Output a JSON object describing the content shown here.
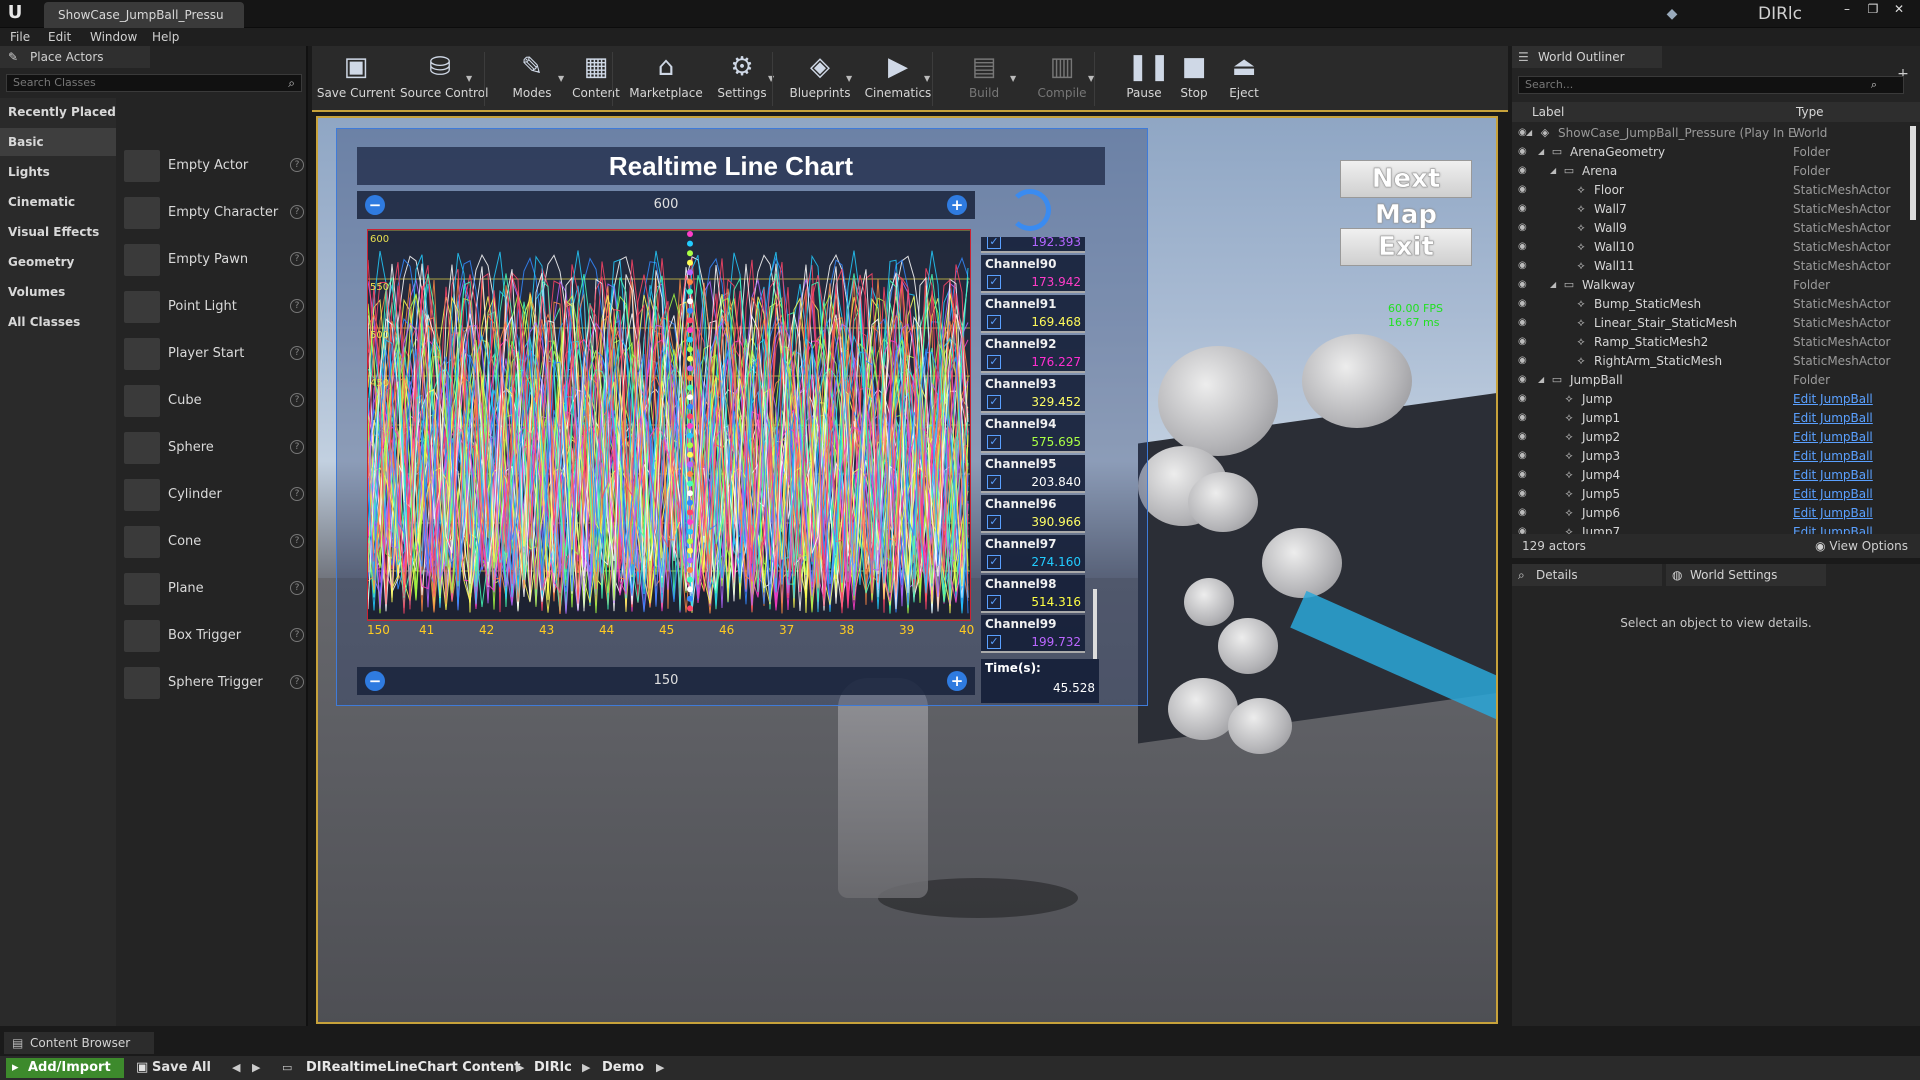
{
  "app": {
    "doc_tab": "ShowCase_JumpBall_Pressu",
    "brand": "DIRlc"
  },
  "menu": [
    "File",
    "Edit",
    "Window",
    "Help"
  ],
  "place_actors": {
    "tab_label": "Place Actors",
    "search_placeholder": "Search Classes",
    "categories": [
      "Recently Placed",
      "Basic",
      "Lights",
      "Cinematic",
      "Visual Effects",
      "Geometry",
      "Volumes",
      "All Classes"
    ],
    "active_category": "Basic",
    "items": [
      "Empty Actor",
      "Empty Character",
      "Empty Pawn",
      "Point Light",
      "Player Start",
      "Cube",
      "Sphere",
      "Cylinder",
      "Cone",
      "Plane",
      "Box Trigger",
      "Sphere Trigger"
    ]
  },
  "toolbar": {
    "items": [
      {
        "label": "Save Current",
        "icon": "save-icon"
      },
      {
        "label": "Source Control",
        "icon": "source-control-icon"
      },
      {
        "label": "Modes",
        "icon": "modes-icon"
      },
      {
        "label": "Content",
        "icon": "content-icon"
      },
      {
        "label": "Marketplace",
        "icon": "marketplace-icon"
      },
      {
        "label": "Settings",
        "icon": "settings-icon"
      },
      {
        "label": "Blueprints",
        "icon": "blueprints-icon"
      },
      {
        "label": "Cinematics",
        "icon": "cinematics-icon"
      },
      {
        "label": "Build",
        "icon": "build-icon"
      },
      {
        "label": "Compile",
        "icon": "compile-icon"
      },
      {
        "label": "Pause",
        "icon": "pause-icon"
      },
      {
        "label": "Stop",
        "icon": "stop-icon"
      },
      {
        "label": "Eject",
        "icon": "eject-icon"
      }
    ]
  },
  "viewport": {
    "next_map_label": "Next Map",
    "exit_label": "Exit",
    "fps": "60.00 FPS",
    "ms": "16.67 ms"
  },
  "chart": {
    "title": "Realtime Line Chart",
    "y_max_value": "600",
    "y_min_value": "150",
    "channels": [
      {
        "name": "Channel90",
        "value": "173.942",
        "color": "#ff3cc8"
      },
      {
        "name": "Channel91",
        "value": "169.468",
        "color": "#fffa5a"
      },
      {
        "name": "Channel92",
        "value": "176.227",
        "color": "#ff2fd0"
      },
      {
        "name": "Channel93",
        "value": "329.452",
        "color": "#ffff66"
      },
      {
        "name": "Channel94",
        "value": "575.695",
        "color": "#aaff44"
      },
      {
        "name": "Channel95",
        "value": "203.840",
        "color": "#ffffff"
      },
      {
        "name": "Channel96",
        "value": "390.966",
        "color": "#ffff66"
      },
      {
        "name": "Channel97",
        "value": "274.160",
        "color": "#22ccff"
      },
      {
        "name": "Channel98",
        "value": "514.316",
        "color": "#ffff44"
      },
      {
        "name": "Channel99",
        "value": "199.732",
        "color": "#bb66ff"
      }
    ],
    "partial_top_value": "192.393",
    "time_label": "Time(s):",
    "time_value": "45.528"
  },
  "chart_data": {
    "type": "line",
    "title": "Realtime Line Chart",
    "xlabel": "",
    "ylabel": "",
    "x_tick_labels": [
      "150",
      "41",
      "42",
      "43",
      "44",
      "45",
      "46",
      "37",
      "38",
      "39",
      "40"
    ],
    "y_tick_labels": [
      "600",
      "550",
      "500",
      "450"
    ],
    "ylim": [
      150,
      600
    ],
    "grid": true,
    "series_count": 100,
    "legend_placement": "right",
    "latest_values": {
      "Channel90": 173.942,
      "Channel91": 169.468,
      "Channel92": 176.227,
      "Channel93": 329.452,
      "Channel94": 575.695,
      "Channel95": 203.84,
      "Channel96": 390.966,
      "Channel97": 274.16,
      "Channel98": 514.316,
      "Channel99": 199.732
    },
    "current_time_s": 45.528
  },
  "outliner": {
    "tab_label": "World Outliner",
    "search_placeholder": "Search...",
    "col_label": "Label",
    "col_type": "Type",
    "rows": [
      {
        "label": "ShowCase_JumpBall_Pressure (Play In E",
        "type": "World",
        "depth": 0,
        "kind": "world"
      },
      {
        "label": "ArenaGeometry",
        "type": "Folder",
        "depth": 1,
        "kind": "folder"
      },
      {
        "label": "Arena",
        "type": "Folder",
        "depth": 2,
        "kind": "folder"
      },
      {
        "label": "Floor",
        "type": "StaticMeshActor",
        "depth": 3,
        "kind": "actor"
      },
      {
        "label": "Wall7",
        "type": "StaticMeshActor",
        "depth": 3,
        "kind": "actor"
      },
      {
        "label": "Wall9",
        "type": "StaticMeshActor",
        "depth": 3,
        "kind": "actor"
      },
      {
        "label": "Wall10",
        "type": "StaticMeshActor",
        "depth": 3,
        "kind": "actor"
      },
      {
        "label": "Wall11",
        "type": "StaticMeshActor",
        "depth": 3,
        "kind": "actor"
      },
      {
        "label": "Walkway",
        "type": "Folder",
        "depth": 2,
        "kind": "folder"
      },
      {
        "label": "Bump_StaticMesh",
        "type": "StaticMeshActor",
        "depth": 3,
        "kind": "actor"
      },
      {
        "label": "Linear_Stair_StaticMesh",
        "type": "StaticMeshActor",
        "depth": 3,
        "kind": "actor"
      },
      {
        "label": "Ramp_StaticMesh2",
        "type": "StaticMeshActor",
        "depth": 3,
        "kind": "actor"
      },
      {
        "label": "RightArm_StaticMesh",
        "type": "StaticMeshActor",
        "depth": 3,
        "kind": "actor"
      },
      {
        "label": "JumpBall",
        "type": "Folder",
        "depth": 1,
        "kind": "folder"
      },
      {
        "label": "Jump",
        "type": "Edit JumpBall",
        "depth": 2,
        "kind": "bp"
      },
      {
        "label": "Jump1",
        "type": "Edit JumpBall",
        "depth": 2,
        "kind": "bp"
      },
      {
        "label": "Jump2",
        "type": "Edit JumpBall",
        "depth": 2,
        "kind": "bp"
      },
      {
        "label": "Jump3",
        "type": "Edit JumpBall",
        "depth": 2,
        "kind": "bp"
      },
      {
        "label": "Jump4",
        "type": "Edit JumpBall",
        "depth": 2,
        "kind": "bp"
      },
      {
        "label": "Jump5",
        "type": "Edit JumpBall",
        "depth": 2,
        "kind": "bp"
      },
      {
        "label": "Jump6",
        "type": "Edit JumpBall",
        "depth": 2,
        "kind": "bp"
      },
      {
        "label": "Jump7",
        "type": "Edit JumpBall",
        "depth": 2,
        "kind": "bp"
      }
    ],
    "actor_count": "129 actors",
    "view_options": "View Options"
  },
  "details": {
    "tab_details": "Details",
    "tab_world_settings": "World Settings",
    "empty_message": "Select an object to view details."
  },
  "content_browser": {
    "tab_label": "Content Browser",
    "add_import": "Add/Import",
    "save_all": "Save All",
    "path": [
      "DIRealtimeLineChart Content",
      "DIRlc",
      "Demo"
    ]
  }
}
